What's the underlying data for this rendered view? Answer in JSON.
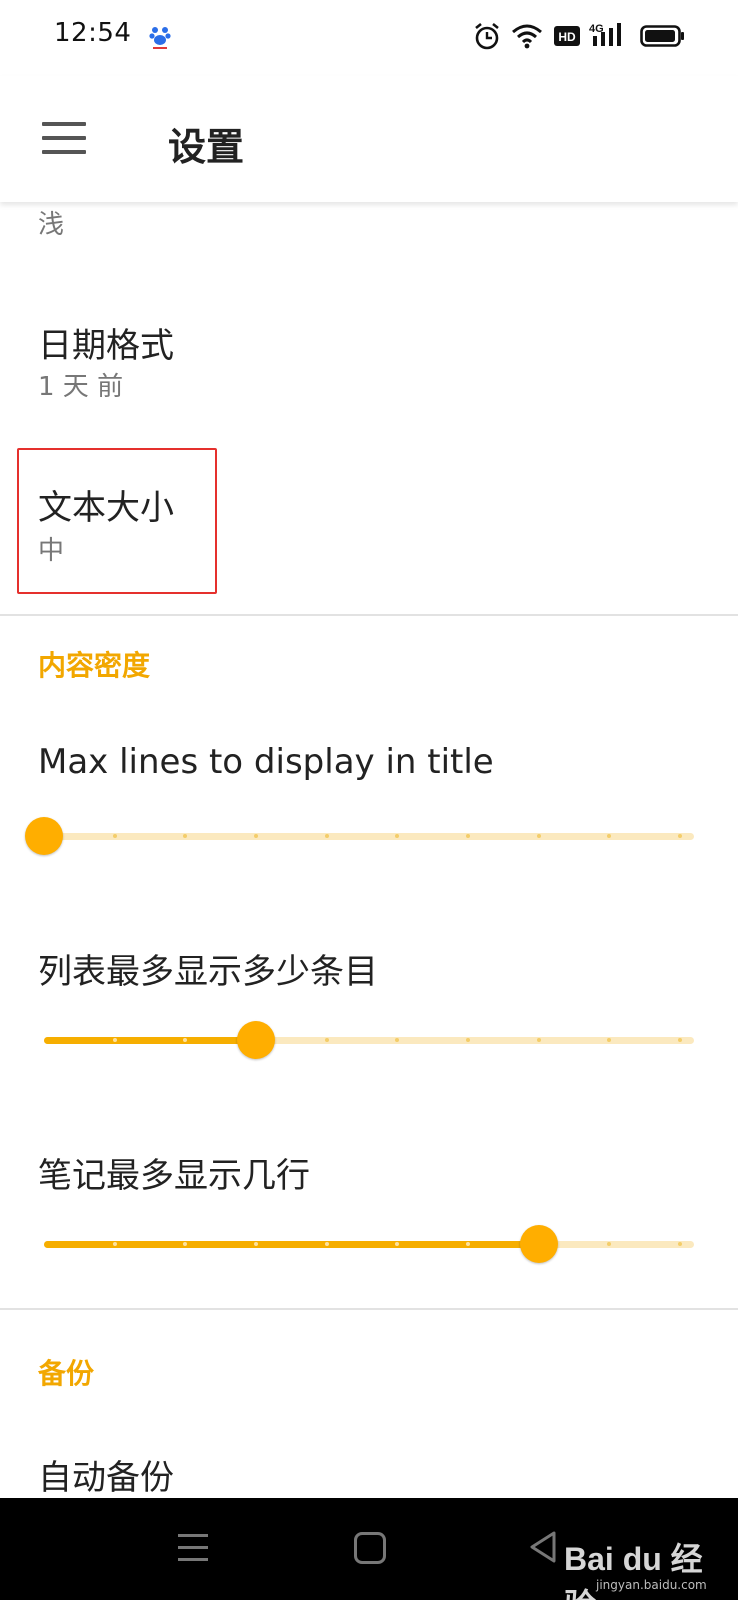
{
  "status_bar": {
    "time": "12:54",
    "app_icon": "baidu-paw-icon",
    "right_icons": [
      "alarm-icon",
      "wifi-icon",
      "hd-icon",
      "signal-4g-icon",
      "battery-icon"
    ],
    "hd_label": "HD",
    "network_label": "4G"
  },
  "app_bar": {
    "menu_icon": "hamburger-menu-icon",
    "title": "设置"
  },
  "preferences": {
    "theme_summary": "浅",
    "date_format": {
      "title": "日期格式",
      "summary": "1 天 前"
    },
    "text_size": {
      "title": "文本大小",
      "summary": "中"
    }
  },
  "density_section": {
    "header": "内容密度",
    "sliders": [
      {
        "title": "Max lines to display in title",
        "value": 0,
        "steps": 9
      },
      {
        "title": "列表最多显示多少条目",
        "value": 3,
        "steps": 9
      },
      {
        "title": "笔记最多显示几行",
        "value": 7,
        "steps": 9
      }
    ]
  },
  "backup_section": {
    "header": "备份",
    "auto_backup": "自动备份"
  },
  "nav_bar": {
    "buttons": [
      "recents-icon",
      "home-icon",
      "back-icon"
    ]
  },
  "watermark": {
    "brand": "Bai du 经验",
    "url": "jingyan.baidu.com"
  },
  "colors": {
    "accent": "#F6AE00",
    "track": "#FBE9BF",
    "highlight": "#E5302D"
  }
}
